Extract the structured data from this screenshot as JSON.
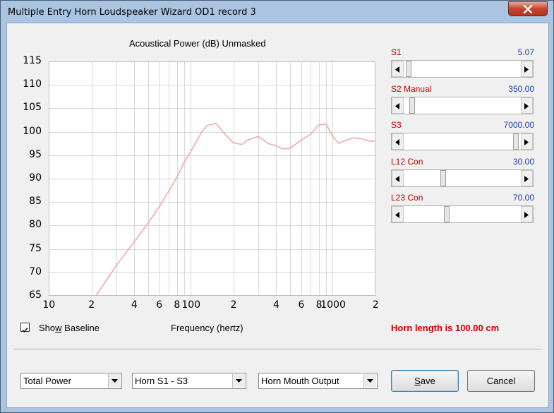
{
  "window": {
    "title": "Multiple Entry Horn Loudspeaker Wizard   OD1 record 3"
  },
  "chart_data": {
    "type": "line",
    "title": "Acoustical Power (dB)   Unmasked",
    "xlabel": "Frequency (hertz)",
    "ylabel": "",
    "xscale": "log",
    "xlim": [
      10,
      2000
    ],
    "ylim": [
      65,
      115
    ],
    "grid": true,
    "yticks": [
      "115",
      "110",
      "105",
      "100",
      "95",
      "90",
      "85",
      "80",
      "75",
      "70",
      "65"
    ],
    "xticks": [
      "10",
      "2",
      "4",
      "6",
      "8",
      "100",
      "2",
      "4",
      "6",
      "8",
      "1000",
      "2"
    ],
    "series": [
      {
        "color": "#f4a8a8",
        "x": [
          21.5,
          30,
          40,
          50,
          60,
          70,
          80,
          90,
          100,
          110,
          120,
          130,
          150,
          180,
          200,
          230,
          250,
          300,
          350,
          400,
          450,
          500,
          600,
          700,
          800,
          900,
          1000,
          1100,
          1200,
          1400,
          1600,
          1800,
          2000
        ],
        "y": [
          65,
          71.5,
          76.5,
          80.5,
          84,
          87.3,
          90.3,
          93.5,
          95.8,
          98,
          100,
          101.3,
          101.8,
          99,
          97.6,
          97.3,
          98.2,
          99,
          97.5,
          97,
          96.3,
          96.5,
          98.2,
          99.5,
          101.5,
          101.6,
          99,
          97.5,
          98,
          98.7,
          98.5,
          98,
          98
        ]
      }
    ]
  },
  "show_baseline": {
    "label": "Show Baseline",
    "checked": true
  },
  "horn_length": "Horn length is 100.00 cm",
  "sliders": [
    {
      "name": "S1",
      "value": "5.07",
      "fraction": 0.02
    },
    {
      "name": "S2  Manual",
      "value": "350.00",
      "fraction": 0.05
    },
    {
      "name": "S3",
      "value": "7000.00",
      "fraction": 0.98
    },
    {
      "name": "L12  Con",
      "value": "30.00",
      "fraction": 0.33
    },
    {
      "name": "L23  Con",
      "value": "70.00",
      "fraction": 0.36
    }
  ],
  "combos": [
    {
      "value": "Total Power"
    },
    {
      "value": "Horn S1 - S3"
    },
    {
      "value": "Horn Mouth Output"
    }
  ],
  "buttons": {
    "save": "Save",
    "cancel": "Cancel"
  },
  "icons": {
    "close": "close-icon",
    "check": "checkmark-icon",
    "left": "arrow-left-icon",
    "right": "arrow-right-icon",
    "dropdown": "chevron-down-icon"
  }
}
